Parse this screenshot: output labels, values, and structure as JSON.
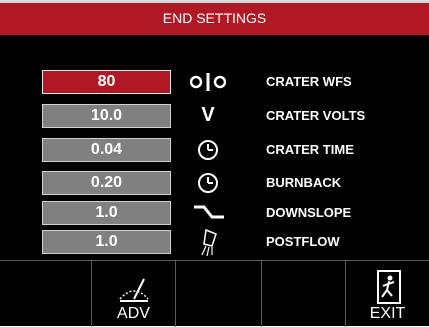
{
  "header": {
    "title": "END SETTINGS"
  },
  "params": [
    {
      "value": "80",
      "label": "CRATER WFS",
      "icon": "wire-feed-icon"
    },
    {
      "value": "10.0",
      "label": "CRATER VOLTS",
      "icon": "volts-icon"
    },
    {
      "value": "0.04",
      "label": "CRATER TIME",
      "icon": "clock-icon"
    },
    {
      "value": "0.20",
      "label": "BURNBACK",
      "icon": "clock-icon"
    },
    {
      "value": "1.0",
      "label": "DOWNSLOPE",
      "icon": "downslope-icon"
    },
    {
      "value": "1.0",
      "label": "POSTFLOW",
      "icon": "gas-flow-icon"
    }
  ],
  "volts_glyph": "V",
  "softkeys": {
    "adv_label": "ADV",
    "exit_label": "EXIT"
  },
  "colors": {
    "accent": "#b01825",
    "value_box": "#808080",
    "background": "#000000"
  }
}
